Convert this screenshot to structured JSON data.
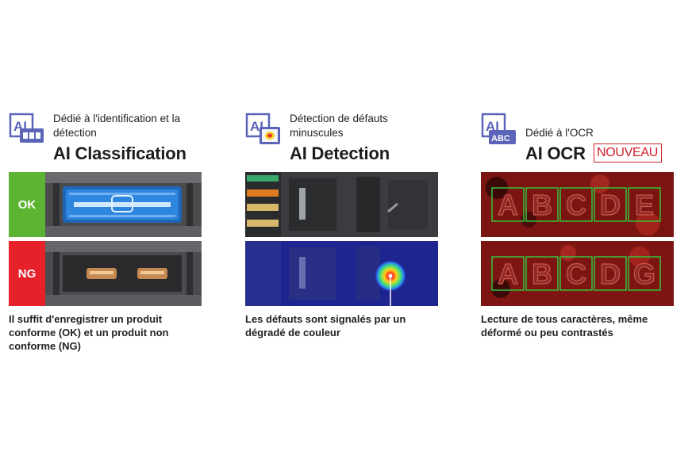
{
  "columns": [
    {
      "id": "classification",
      "icon": "ai-classification-icon",
      "subtitle": "Dédié à l'identification et la détection",
      "title": "AI Classification",
      "labels": {
        "ok": "OK",
        "ng": "NG"
      },
      "caption": "Il suffit d'enregistrer un produit conforme (OK) et un produit non conforme (NG)"
    },
    {
      "id": "detection",
      "icon": "ai-detection-icon",
      "subtitle": "Détection de défauts minuscules",
      "title": "AI Detection",
      "caption": "Les défauts sont signalés par un dégradé de couleur"
    },
    {
      "id": "ocr",
      "icon": "ai-ocr-icon",
      "subtitle": "Dédié à l'OCR",
      "title": "AI OCR",
      "badge": "NOUVEAU",
      "caption": "Lecture de tous caractères, même déformé ou peu contrastés"
    }
  ],
  "icon_text": {
    "ai": "AI",
    "abc": "ABC"
  },
  "colors": {
    "ok": "#5db332",
    "ng": "#e62129",
    "badge": "#d0202a",
    "icon": "#5b64b8"
  },
  "ocr_letters": {
    "top": [
      "A",
      "B",
      "C",
      "D",
      "E"
    ],
    "bottom": [
      "A",
      "B",
      "C",
      "D",
      "G"
    ]
  }
}
